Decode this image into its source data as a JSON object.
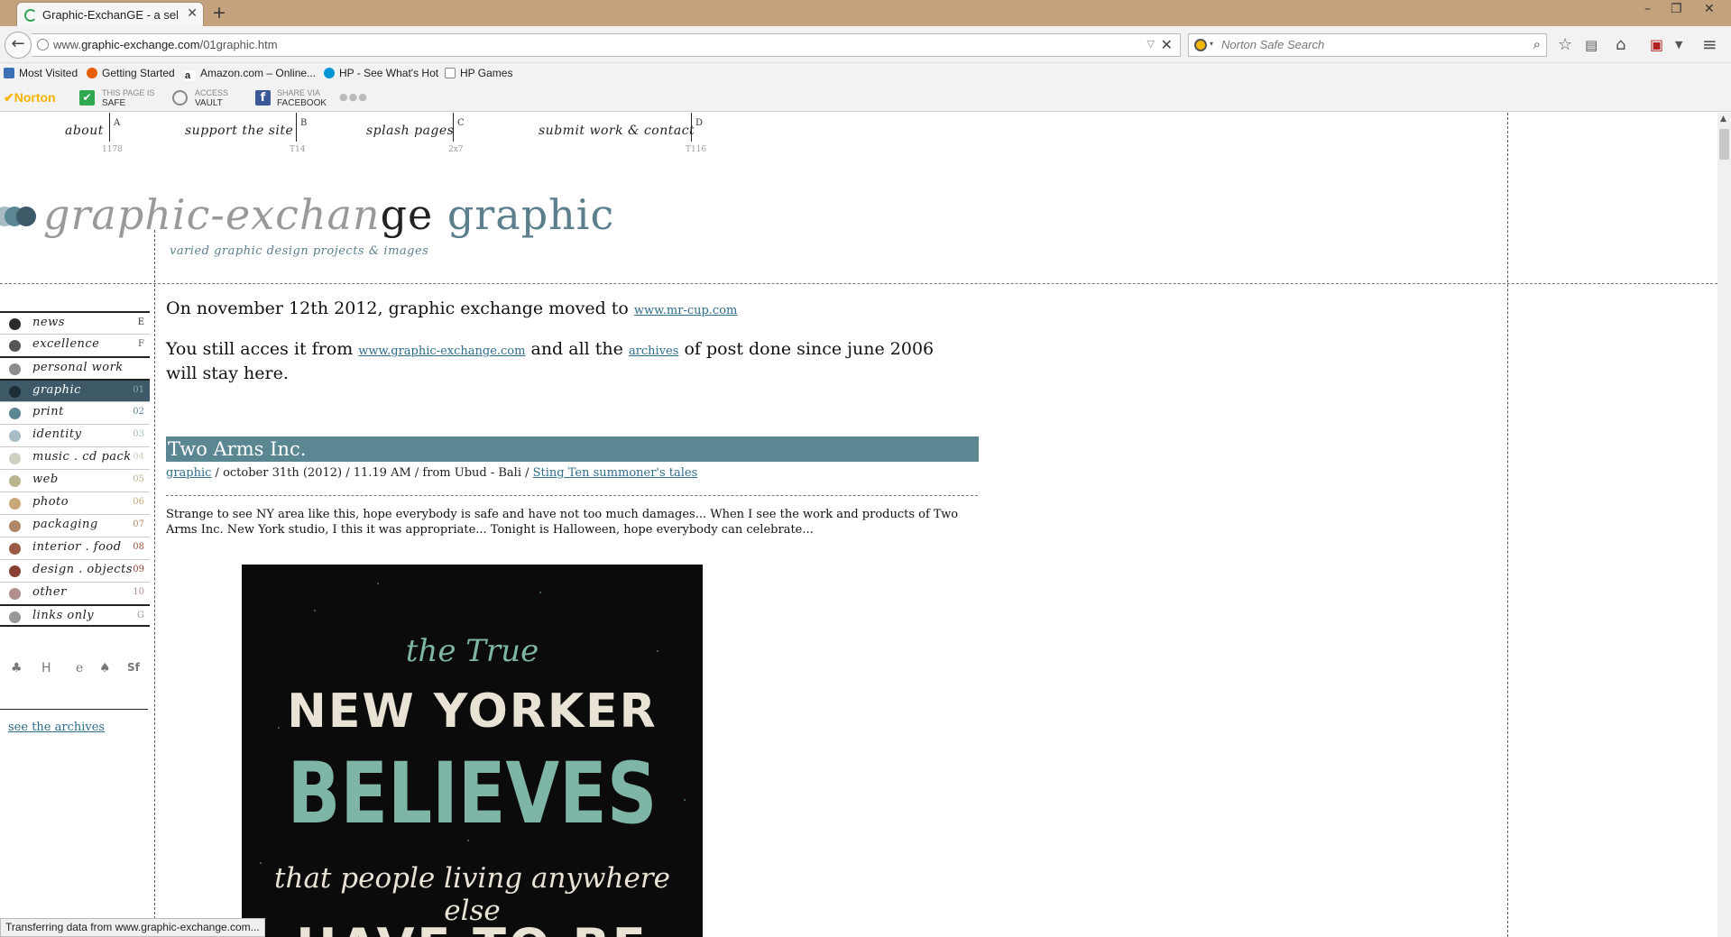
{
  "browser": {
    "tab_title": "Graphic-ExchanGE - a selec...",
    "url_prefix": "www.",
    "url_domain": "graphic-exchange.com",
    "url_path": "/01graphic.htm",
    "search_placeholder": "Norton Safe Search",
    "bookmarks": [
      {
        "label": "Most Visited",
        "icon": "star-folder-icon",
        "color": "#3b6fb6"
      },
      {
        "label": "Getting Started",
        "icon": "firefox-icon",
        "color": "#e66000"
      },
      {
        "label": "Amazon.com – Online...",
        "icon": "amazon-icon",
        "color": "#222222"
      },
      {
        "label": "HP - See What's Hot",
        "icon": "hp-icon",
        "color": "#0096d6"
      },
      {
        "label": "HP Games",
        "icon": "page-icon",
        "color": "#ffffff"
      }
    ],
    "norton": {
      "brand": "Norton",
      "safe_small": "THIS PAGE IS",
      "safe_big": "SAFE",
      "vault_small": "ACCESS",
      "vault_big": "VAULT",
      "fb_small": "SHARE VIA",
      "fb_big": "FACEBOOK"
    },
    "status_text": "Transferring data from www.graphic-exchange.com..."
  },
  "topnav": [
    {
      "label": "about",
      "letter": "A",
      "count": "1178"
    },
    {
      "label": "support the site",
      "letter": "B",
      "count": "T14"
    },
    {
      "label": "splash pages",
      "letter": "C",
      "count": "2x7"
    },
    {
      "label": "submit work & contact",
      "letter": "D",
      "count": "T116"
    }
  ],
  "site": {
    "title_part1": "graphic-exchan",
    "title_part2": "ge",
    "title_part3": "graphic",
    "subtitle": "varied graphic design projects & images",
    "accent": "#5b7f8c"
  },
  "categories": [
    {
      "label": "news",
      "num": "E",
      "color": "#2b2b2b"
    },
    {
      "label": "excellence",
      "num": "F",
      "color": "#555555"
    },
    {
      "label": "personal work",
      "num": "",
      "color": "#8c8c8c"
    },
    {
      "label": "graphic",
      "num": "01",
      "color": "#2a3f4a",
      "active": true
    },
    {
      "label": "print",
      "num": "02",
      "color": "#5b8793"
    },
    {
      "label": "identity",
      "num": "03",
      "color": "#a8bcc6"
    },
    {
      "label": "music . cd pack",
      "num": "04",
      "color": "#cfd0c2"
    },
    {
      "label": "web",
      "num": "05",
      "color": "#b9b58d"
    },
    {
      "label": "photo",
      "num": "06",
      "color": "#c9a877"
    },
    {
      "label": "packaging",
      "num": "07",
      "color": "#b08766"
    },
    {
      "label": "interior . food",
      "num": "08",
      "color": "#9b5a48"
    },
    {
      "label": "design . objects",
      "num": "09",
      "color": "#8a3f33"
    },
    {
      "label": "other",
      "num": "10",
      "color": "#b0908c"
    },
    {
      "label": "links only",
      "num": "G",
      "color": "#999999"
    }
  ],
  "social_icons": [
    "tree-icon",
    "hi-icon",
    "e-icon",
    "balloon-icon",
    "sf-icon"
  ],
  "archives_link": "see the archives",
  "notice": {
    "line1_text": "On november 12th 2012, graphic exchange moved to ",
    "line1_link": "www.mr-cup.com",
    "line2_text_a": "You still acces it from ",
    "line2_link_a": "www.graphic-exchange.com",
    "line2_text_b": " and all the ",
    "line2_link_b": "archives",
    "line2_text_c": " of post done since june 2006 will stay here."
  },
  "post": {
    "title": "Two Arms Inc.",
    "category_link": "graphic",
    "meta_text": " / october 31th (2012) / 11.19 AM / from Ubud - Bali / ",
    "author_link": "Sting Ten summoner's tales",
    "body": "Strange to see NY area like this, hope everybody is safe and have not too much damages... When I see the work and products of Two Arms Inc. New York studio, I this it was appropriate... Tonight is Halloween, hope everybody can celebrate..."
  },
  "poster": {
    "line1": "the True",
    "line2": "NEW YORKER",
    "line3": "BELIEVES",
    "line4": "that people living anywhere else",
    "line5": "HAVE TO BE"
  }
}
